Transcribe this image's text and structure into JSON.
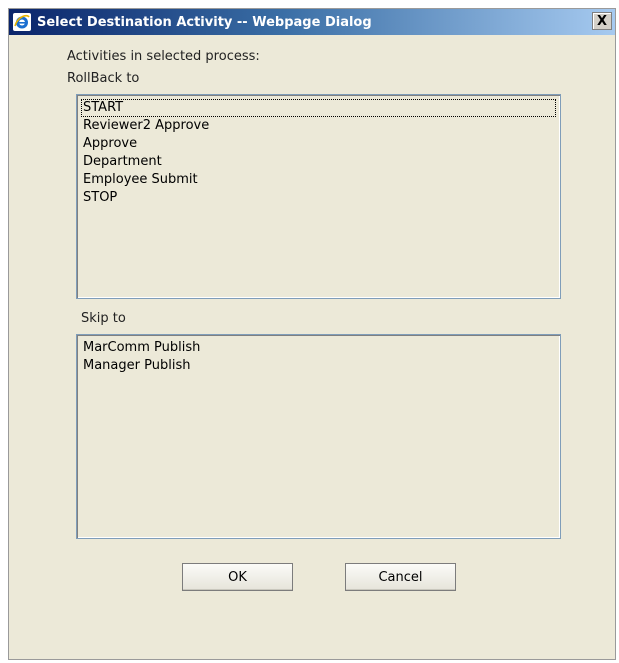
{
  "window": {
    "title": "Select Destination Activity -- Webpage Dialog",
    "close_glyph": "X"
  },
  "header": {
    "activities_label": "Activities in selected process:"
  },
  "rollback": {
    "label": "RollBack to",
    "items": [
      "START",
      "Reviewer2 Approve",
      "Approve",
      "Department",
      "Employee Submit",
      "STOP"
    ],
    "selected_index": 0
  },
  "skip": {
    "label": "Skip to",
    "items": [
      "MarComm Publish",
      "Manager Publish"
    ]
  },
  "buttons": {
    "ok_label": "OK",
    "cancel_label": "Cancel"
  },
  "icons": {
    "app": "internet-explorer-icon",
    "close": "close-icon"
  },
  "colors": {
    "titlebar_start": "#0a246a",
    "titlebar_end": "#a6caf0",
    "dialog_bg": "#ece9d8",
    "listbox_border": "#7f9db9"
  }
}
